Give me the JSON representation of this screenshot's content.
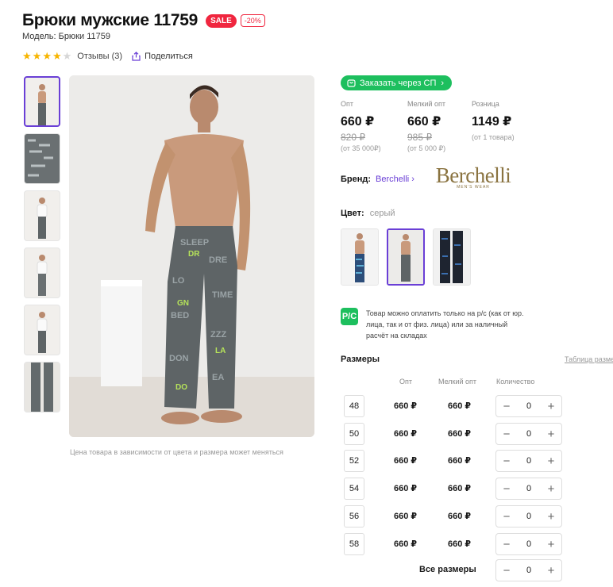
{
  "product": {
    "title": "Брюки мужские 11759",
    "sale_badge": "SALE",
    "discount_badge": "-20%",
    "model": "Модель: Брюки 11759",
    "rating": 4,
    "rating_max": 5,
    "reviews": "Отзывы (3)",
    "share": "Поделиться"
  },
  "gallery": {
    "caption": "Цена товара в зависимости от цвета и размера может меняться",
    "thumbnails": 6,
    "active_thumbnail": 1
  },
  "order_button": "Заказать через СП",
  "prices": [
    {
      "label": "Опт",
      "current": "660 ₽",
      "old": "820 ₽",
      "min": "(от 35 000₽)"
    },
    {
      "label": "Мелкий опт",
      "current": "660 ₽",
      "old": "985 ₽",
      "min": "(от 5 000 ₽)"
    },
    {
      "label": "Розница",
      "current": "1149 ₽",
      "old": "",
      "min": "(от 1 товара)"
    }
  ],
  "brand": {
    "label": "Бренд:",
    "name": "Berchelli",
    "logo_text": "Berchelli",
    "logo_sub": "MEN'S WEAR"
  },
  "color": {
    "label": "Цвет:",
    "value": "серый",
    "swatches": [
      "синий",
      "серый",
      "черный"
    ],
    "active_index": 1
  },
  "payment_note": {
    "icon_text": "Р/С",
    "text": "Товар можно оплатить только на р/с (как от юр. лица, так и от физ. лица) или за наличный расчёт на складах"
  },
  "sizes": {
    "title": "Размеры",
    "table_link": "Таблица размеров",
    "headers": {
      "opt": "Опт",
      "small_opt": "Мелкий опт",
      "qty": "Количество"
    },
    "rows": [
      {
        "size": "48",
        "opt": "660 ₽",
        "small_opt": "660 ₽",
        "qty": "0"
      },
      {
        "size": "50",
        "opt": "660 ₽",
        "small_opt": "660 ₽",
        "qty": "0"
      },
      {
        "size": "52",
        "opt": "660 ₽",
        "small_opt": "660 ₽",
        "qty": "0"
      },
      {
        "size": "54",
        "opt": "660 ₽",
        "small_opt": "660 ₽",
        "qty": "0"
      },
      {
        "size": "56",
        "opt": "660 ₽",
        "small_opt": "660 ₽",
        "qty": "0"
      },
      {
        "size": "58",
        "opt": "660 ₽",
        "small_opt": "660 ₽",
        "qty": "0"
      }
    ],
    "all_label": "Все размеры",
    "all_qty": "0",
    "minus": "−",
    "plus": "+"
  },
  "colors": {
    "accent": "#6a3fd6",
    "green": "#1dbf5e",
    "sale": "#f0263f",
    "star": "#f7b500"
  },
  "icons": [
    "star-icon",
    "share-icon",
    "cart-icon",
    "chevron-right-icon",
    "payment-rs-icon"
  ]
}
